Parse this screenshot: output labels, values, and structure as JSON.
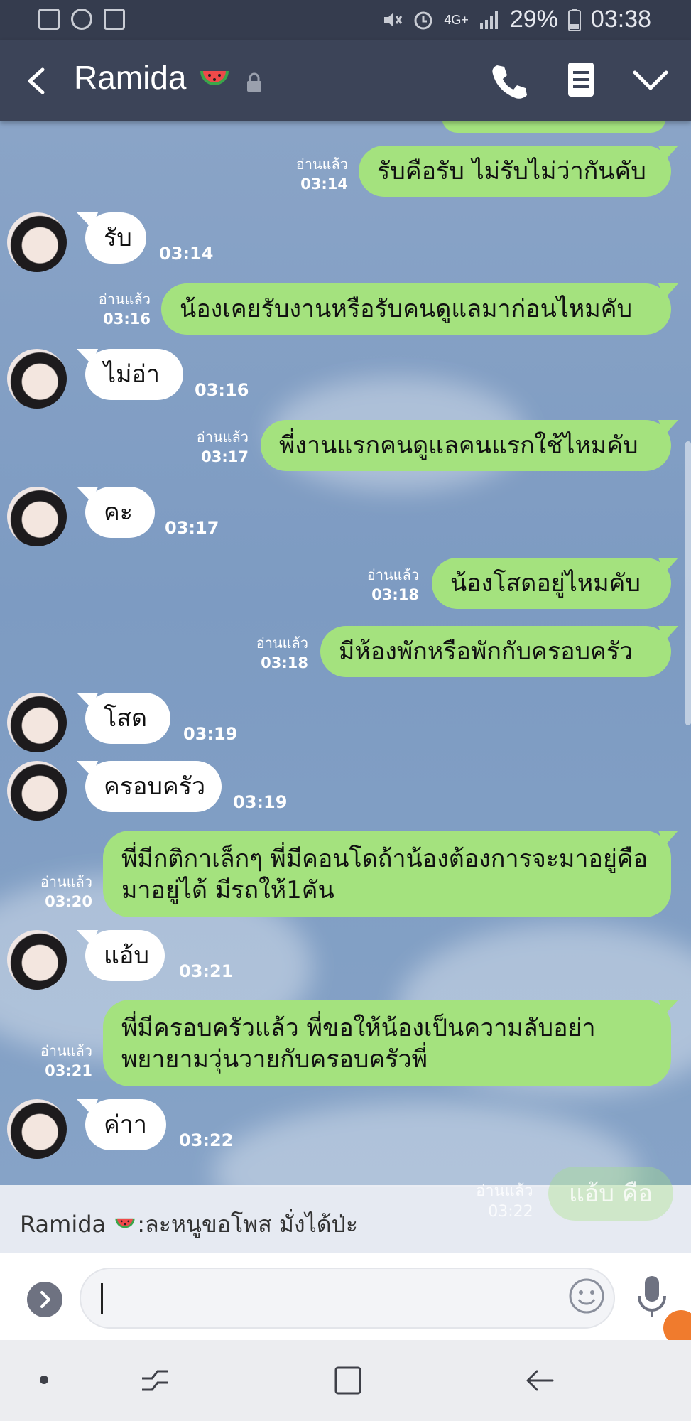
{
  "status_bar": {
    "network": "4G+",
    "battery": "29%",
    "time": "03:38"
  },
  "header": {
    "contact_name": "Ramida"
  },
  "messages": [
    {
      "dir": "out",
      "text": "รับคือรับ ไม่รับไม่ว่ากันคับ",
      "read": "อ่านแล้ว",
      "time": "03:14"
    },
    {
      "dir": "in",
      "text": "รับ",
      "time": "03:14"
    },
    {
      "dir": "out",
      "text": "น้องเคยรับงานหรือรับคนดูแลมาก่อนไหมคับ",
      "read": "อ่านแล้ว",
      "time": "03:16"
    },
    {
      "dir": "in",
      "text": "ไม่อ่า",
      "time": "03:16"
    },
    {
      "dir": "out",
      "text": "พี่งานแรกคนดูแลคนแรกใช้ไหมคับ",
      "read": "อ่านแล้ว",
      "time": "03:17"
    },
    {
      "dir": "in",
      "text": "คะ",
      "time": "03:17"
    },
    {
      "dir": "out",
      "text": "น้องโสดอยู่ไหมคับ",
      "read": "อ่านแล้ว",
      "time": "03:18"
    },
    {
      "dir": "out",
      "text": "มีห้องพักหรือพักกับครอบครัว",
      "read": "อ่านแล้ว",
      "time": "03:18"
    },
    {
      "dir": "in",
      "text": "โสด",
      "time": "03:19"
    },
    {
      "dir": "in",
      "text": "ครอบครัว",
      "time": "03:19"
    },
    {
      "dir": "out",
      "text": "พี่มีกติกาเล็กๆ พี่มีคอนโดถ้าน้องต้องการจะมาอยู่คือมาอยู่ได้ มีรถให้1คัน",
      "read": "อ่านแล้ว",
      "time": "03:20"
    },
    {
      "dir": "in",
      "text": "แอ้บ",
      "time": "03:21"
    },
    {
      "dir": "out",
      "text": "พี่มีครอบครัวแล้ว พี่ขอให้น้องเป็นความลับอย่าพยายามวุ่นวายกับครอบครัวพี่",
      "read": "อ่านแล้ว",
      "time": "03:21"
    },
    {
      "dir": "in",
      "text": "ค่าา",
      "time": "03:22"
    }
  ],
  "last_ghost": {
    "read": "อ่านแล้ว",
    "time": "03:22",
    "text": "แอ้บ คือ"
  },
  "notification": {
    "sender": "Ramida",
    "text": ":ละหนูขอโพส มั่งได้ป่ะ"
  },
  "colors": {
    "header_bg": "#3c4458",
    "outgoing_bubble": "#a4e27e",
    "incoming_bubble": "#ffffff",
    "chat_bg": "#7f9bc0"
  },
  "icons": [
    "back-icon",
    "watermelon-icon",
    "lock-icon",
    "call-icon",
    "note-icon",
    "chevron-down-icon",
    "expand-icon",
    "emoji-icon",
    "mic-icon"
  ]
}
